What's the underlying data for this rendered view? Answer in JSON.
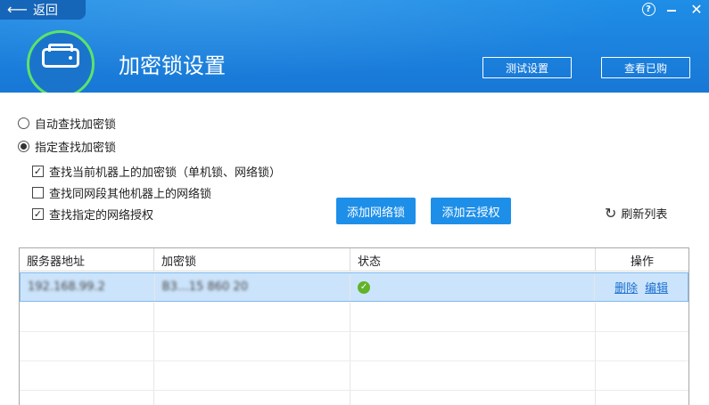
{
  "header": {
    "back_label": "返回",
    "title": "加密锁设置",
    "test_button": "测试设置",
    "purchased_button": "查看已购",
    "colors": {
      "header_bg": "#1a80dc",
      "logo_ring": "#5ce36a"
    }
  },
  "options": {
    "auto_find": {
      "label": "自动查找加密锁",
      "selected": false
    },
    "specified_find": {
      "label": "指定查找加密锁",
      "selected": true
    },
    "check_local": {
      "label": "查找当前机器上的加密锁（单机锁、网络锁）",
      "checked": true
    },
    "check_segment": {
      "label": "查找同网段其他机器上的网络锁",
      "checked": false
    },
    "check_specified": {
      "label": "查找指定的网络授权",
      "checked": true
    }
  },
  "actions": {
    "add_network_lock": "添加网络锁",
    "add_cloud_license": "添加云授权",
    "refresh_list": "刷新列表"
  },
  "table": {
    "columns": [
      "服务器地址",
      "加密锁",
      "状态",
      "操作"
    ],
    "rows": [
      {
        "server": "192.168.99.2",
        "lock": "B3…15 860 20",
        "status": "ok",
        "delete": "删除",
        "edit": "编辑"
      }
    ]
  }
}
